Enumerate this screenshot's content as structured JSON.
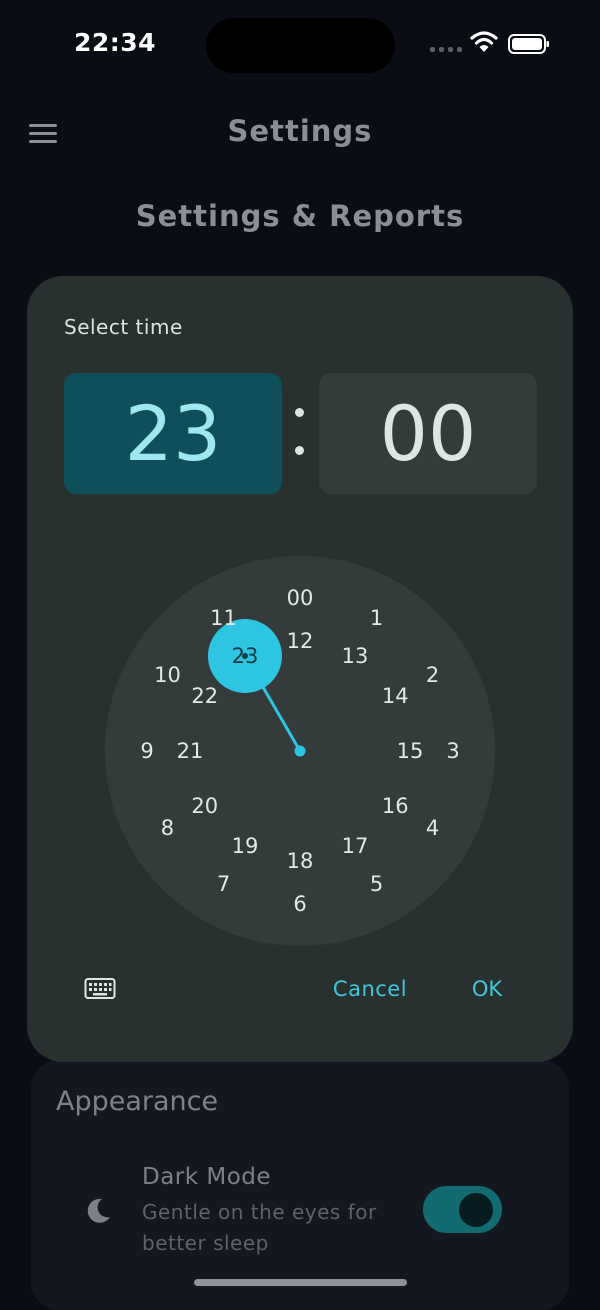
{
  "status_bar": {
    "time": "22:34",
    "icons": [
      "signal-icon",
      "wifi-icon",
      "battery-icon"
    ]
  },
  "app_bar": {
    "title": "Settings",
    "menu_icon": "menu-icon"
  },
  "page": {
    "section_title": "Settings & Reports"
  },
  "time_picker": {
    "label": "Select time",
    "hour": "23",
    "minute": "00",
    "selected_hour": "23",
    "outer_ring": [
      "00",
      "1",
      "2",
      "3",
      "4",
      "5",
      "6",
      "7",
      "8",
      "9",
      "10",
      "11"
    ],
    "inner_ring": [
      "12",
      "13",
      "14",
      "15",
      "16",
      "17",
      "18",
      "19",
      "20",
      "21",
      "22",
      "23"
    ],
    "keyboard_icon": "keyboard-icon",
    "cancel_label": "Cancel",
    "ok_label": "OK",
    "accent_color": "#3fc7de"
  },
  "appearance": {
    "title": "Appearance",
    "dark_mode": {
      "icon": "moon-icon",
      "label": "Dark Mode",
      "description": "Gentle on the eyes for better sleep",
      "enabled": true
    }
  }
}
